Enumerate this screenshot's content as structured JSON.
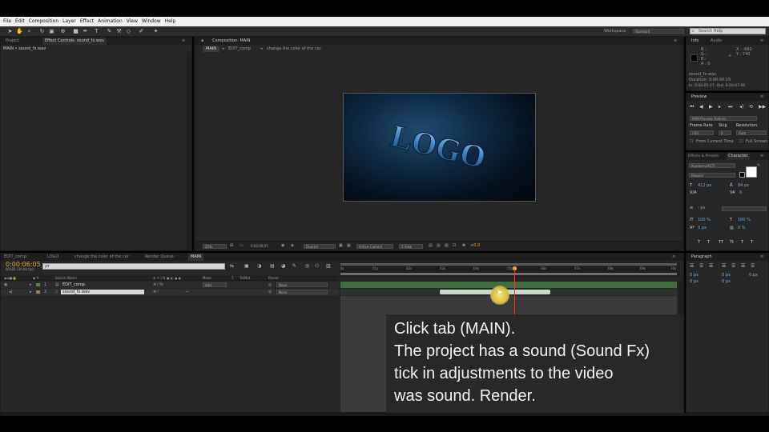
{
  "menu": {
    "items": [
      "File",
      "Edit",
      "Composition",
      "Layer",
      "Effect",
      "Animation",
      "View",
      "Window",
      "Help"
    ]
  },
  "toolbar": {
    "workspace_label": "Workspace:",
    "workspace_value": "Standard",
    "search_placeholder": "Search Help"
  },
  "project_panel": {
    "tab_project": "Project",
    "tab_effect_controls": "Effect Controls: sound_fx.wav",
    "breadcrumb": "MAIN • sound_fx.wav"
  },
  "composition_panel": {
    "tab_label": "Composition: MAIN",
    "subtabs": [
      "MAIN",
      "EDIT_comp",
      "change the color of the car"
    ],
    "logo_text": "LOGO",
    "zoom": "25%",
    "timecode": "0;00;06;05",
    "resolution": "Quarter",
    "camera": "Active Camera",
    "view": "1 View",
    "exposure": "+0.0"
  },
  "info_panel": {
    "tab_info": "Info",
    "tab_audio": "Audio",
    "r": "R :",
    "g": "G :",
    "b": "B :",
    "a": "A : 0",
    "x": "X : -692",
    "y": "Y : 740",
    "file": "sound_fx.wav",
    "duration": "Duration: 0:00:00:15",
    "inout": "In: 0:00:05:27, Out: 0:00:07:06"
  },
  "preview_panel": {
    "title": "Preview",
    "ram_options": "RAM Preview Options",
    "frame_rate_label": "Frame Rate",
    "skip_label": "Skip",
    "resolution_label": "Resolution",
    "frame_rate_value": "(30)",
    "skip_value": "0",
    "resolution_value": "Auto",
    "from_current": "From Current Time",
    "full_screen": "Full Screen"
  },
  "character_panel": {
    "tab_effects": "Effects & Presets",
    "tab_character": "Character",
    "font": "Academy(ACT)",
    "style": "Regular",
    "size": "412 px",
    "leading": "84 px",
    "tracking": "0",
    "stroke": "- px",
    "vscale": "100 %",
    "hscale": "100 %",
    "baseline": "0 px",
    "tsume": "0 %",
    "format_buttons": [
      "T",
      "T",
      "TT",
      "Tt",
      "T",
      "T"
    ]
  },
  "paragraph_panel": {
    "title": "Paragraph",
    "indent_values": [
      "0 px",
      "0 px",
      "0 px",
      "0 px",
      "0 px"
    ]
  },
  "timeline": {
    "tabs": [
      "EDIT_comp",
      "LOGO",
      "change the color of the car",
      "Render Queue",
      "MAIN"
    ],
    "timecode": "0:00:06:05",
    "fps": "00185 (30.00 fps)",
    "search_placeholder": "ρ▾",
    "col_source": "Source Name",
    "col_mode": "Mode",
    "col_t": "T",
    "col_trkmat": "TrkMat",
    "col_parent": "Parent",
    "layers": [
      {
        "num": "1",
        "name": "EDIT_comp",
        "mode": "Add",
        "parent": "None"
      },
      {
        "num": "2",
        "name": "sound_fx.wav",
        "mode": "",
        "parent": "None"
      }
    ],
    "ruler": [
      "0s",
      "01s",
      "02s",
      "03s",
      "04s",
      "05s",
      "06s",
      "07s",
      "08s",
      "09s",
      "10s"
    ]
  },
  "caption": {
    "lines": [
      "Click tab (MAIN).",
      "The project has a sound (Sound Fx)",
      "tick in adjustments to the video",
      "was sound. Render."
    ]
  }
}
